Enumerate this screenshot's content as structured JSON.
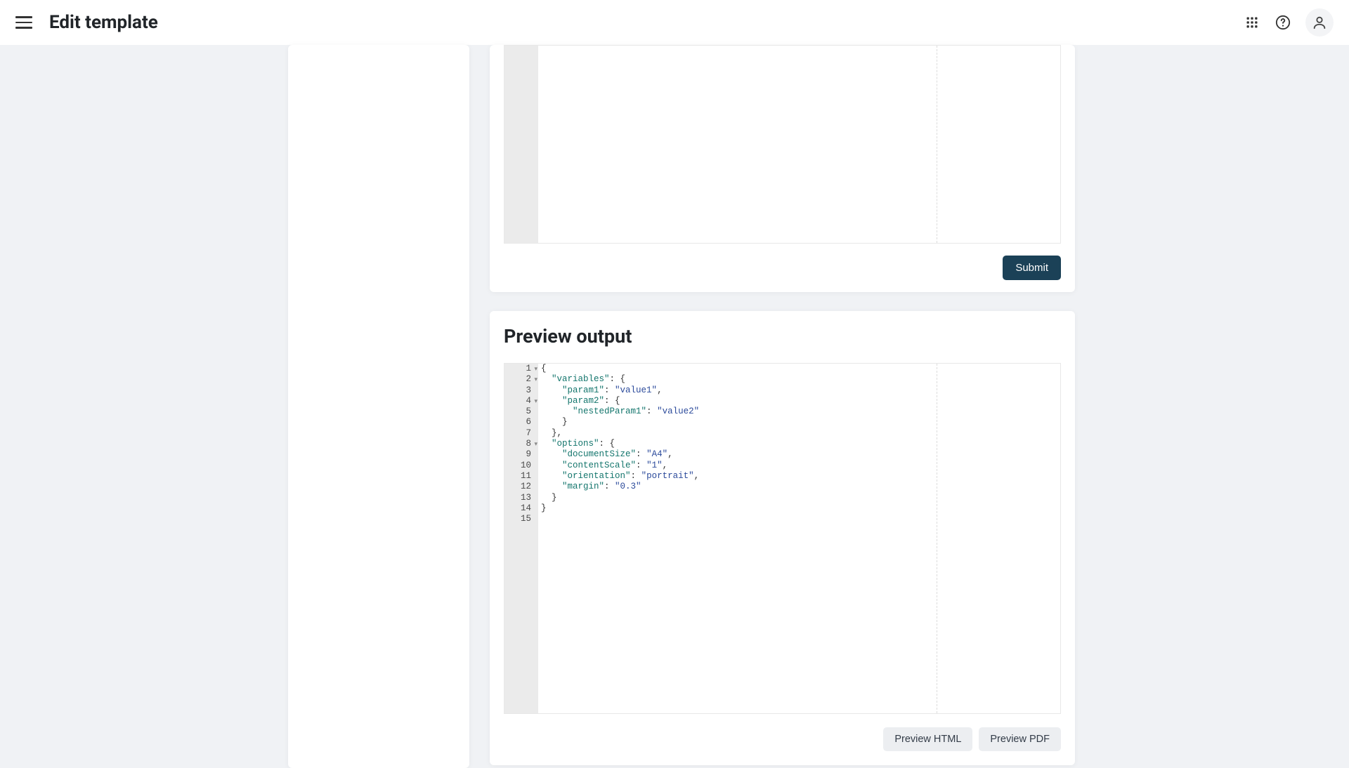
{
  "header": {
    "title": "Edit template"
  },
  "submit": {
    "button_label": "Submit"
  },
  "preview": {
    "title": "Preview output",
    "preview_html_label": "Preview HTML",
    "preview_pdf_label": "Preview PDF",
    "code": {
      "lines": [
        {
          "num": "1",
          "foldable": true
        },
        {
          "num": "2",
          "foldable": true
        },
        {
          "num": "3",
          "foldable": false
        },
        {
          "num": "4",
          "foldable": true
        },
        {
          "num": "5",
          "foldable": false
        },
        {
          "num": "6",
          "foldable": false
        },
        {
          "num": "7",
          "foldable": false
        },
        {
          "num": "8",
          "foldable": true
        },
        {
          "num": "9",
          "foldable": false
        },
        {
          "num": "10",
          "foldable": false
        },
        {
          "num": "11",
          "foldable": false
        },
        {
          "num": "12",
          "foldable": false
        },
        {
          "num": "13",
          "foldable": false
        },
        {
          "num": "14",
          "foldable": false
        },
        {
          "num": "15",
          "foldable": false
        }
      ],
      "json": {
        "variables": {
          "param1": "value1",
          "param2": {
            "nestedParam1": "value2"
          }
        },
        "options": {
          "documentSize": "A4",
          "contentScale": "1",
          "orientation": "portrait",
          "margin": "0.3"
        }
      }
    }
  }
}
